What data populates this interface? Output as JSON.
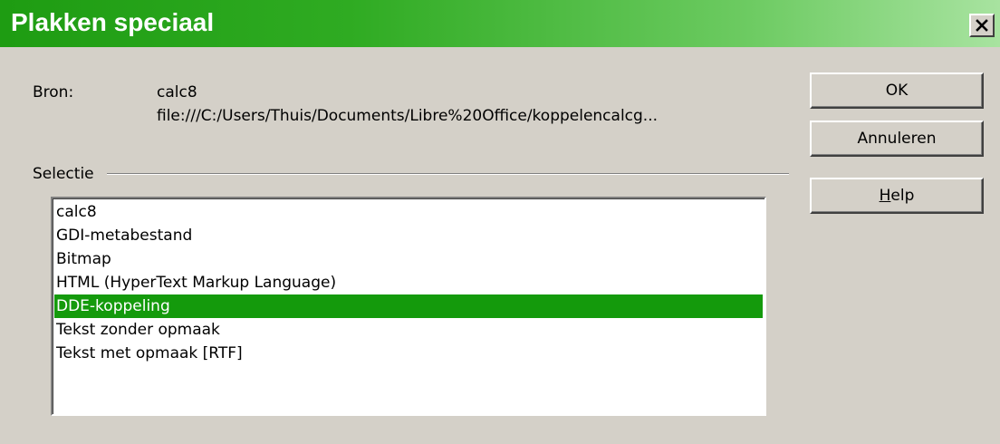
{
  "dialog": {
    "title": "Plakken speciaal",
    "close_glyph": "×"
  },
  "source": {
    "label": "Bron:",
    "name": "calc8",
    "path": "file:///C:/Users/Thuis/Documents/Libre%20Office/koppelencalcg..."
  },
  "selection": {
    "label": "Selectie",
    "items": [
      {
        "label": "calc8",
        "selected": false
      },
      {
        "label": "GDI-metabestand",
        "selected": false
      },
      {
        "label": "Bitmap",
        "selected": false
      },
      {
        "label": "HTML (HyperText Markup Language)",
        "selected": false
      },
      {
        "label": "DDE-koppeling",
        "selected": true
      },
      {
        "label": "Tekst zonder opmaak",
        "selected": false
      },
      {
        "label": "Tekst met opmaak [RTF]",
        "selected": false
      }
    ]
  },
  "buttons": {
    "ok": "OK",
    "cancel": "Annuleren",
    "help_mnemonic": "H",
    "help_rest": "elp"
  },
  "colors": {
    "title_gradient_start": "#1e9c12",
    "title_gradient_end": "#a8e3a0",
    "selection_highlight": "#149a0c",
    "dialog_background": "#d4d0c8"
  },
  "icons": {
    "close": "close-icon"
  }
}
